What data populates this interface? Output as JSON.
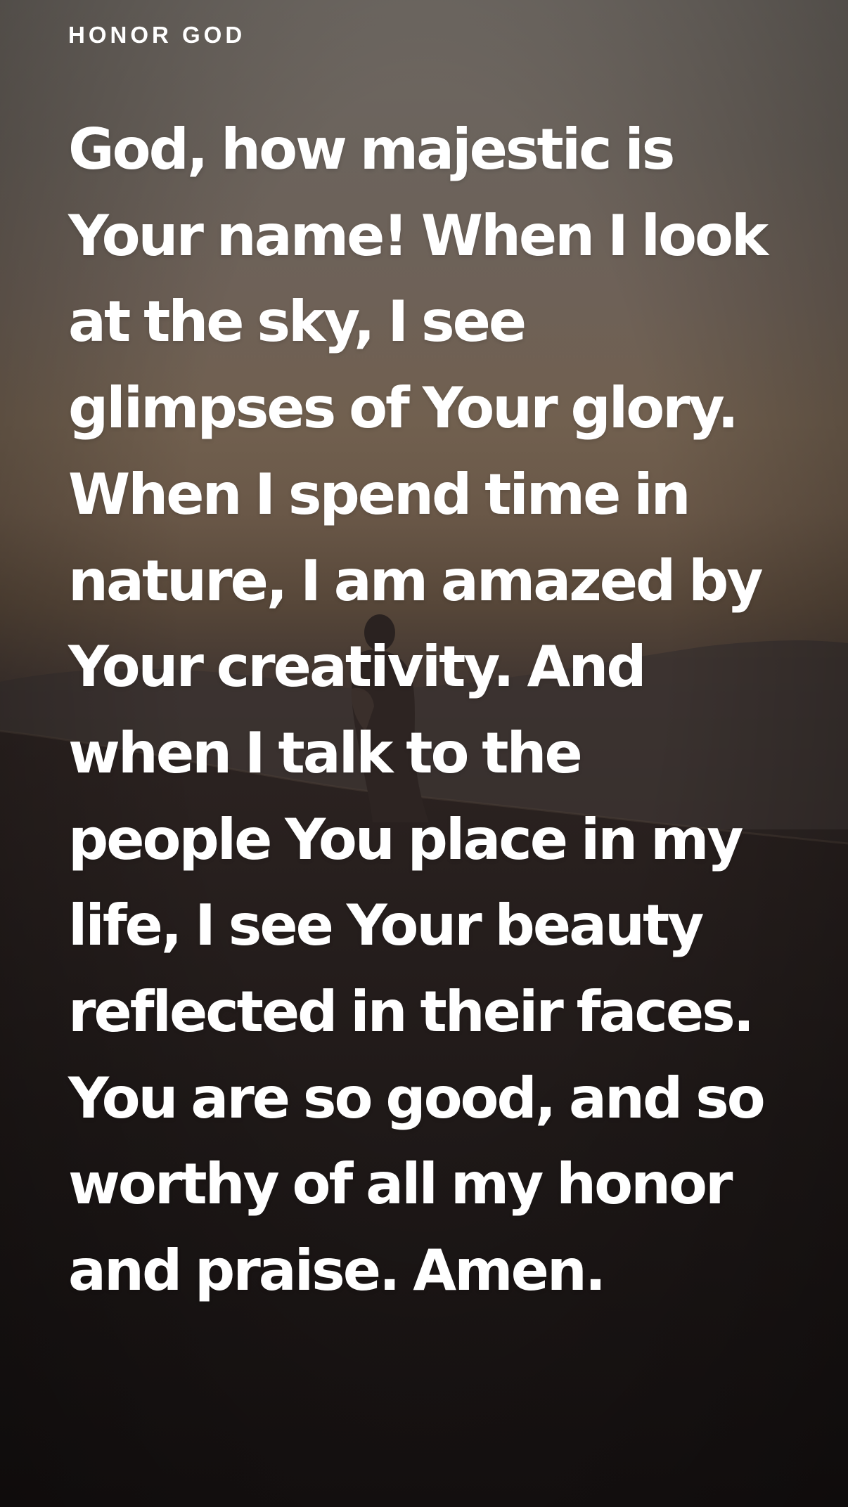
{
  "header": {
    "category_label": "HONOR GOD"
  },
  "prayer": {
    "lines": [
      "God, how majestic is",
      "Your name! When I look",
      "at the sky, I see",
      "glimpses of Your glory.",
      "When I spend time in",
      "nature, I am amazed by",
      "Your creativity. And",
      "when I talk to the",
      "people You place in my",
      "life, I see Your beauty",
      "reflected in their faces.",
      "You are so good, and so",
      "worthy of all my honor",
      "and praise. Amen."
    ]
  },
  "colors": {
    "text": "#ffffff",
    "sky_top": "#6e6862",
    "horizon_glow": "#71604f",
    "ground_dark": "#181313"
  }
}
